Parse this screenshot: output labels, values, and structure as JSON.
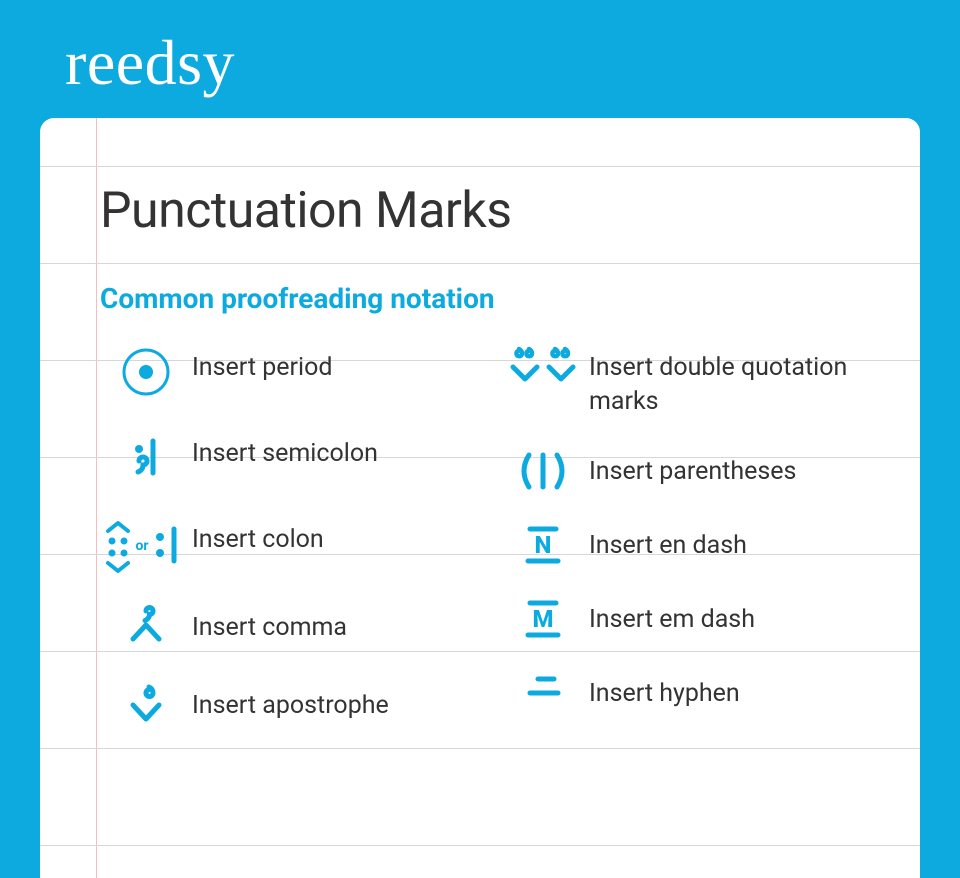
{
  "brand": {
    "name": "reedsy"
  },
  "heading": "Punctuation Marks",
  "subheading": "Common proofreading notation",
  "colon_or": "or",
  "marks": {
    "left": [
      {
        "label": "Insert period"
      },
      {
        "label": "Insert semicolon"
      },
      {
        "label": "Insert colon"
      },
      {
        "label": "Insert comma"
      },
      {
        "label": "Insert apostrophe"
      }
    ],
    "right": [
      {
        "label": "Insert double quotation marks"
      },
      {
        "label": "Insert parentheses"
      },
      {
        "label": "Insert en dash"
      },
      {
        "label": "Insert em dash"
      },
      {
        "label": "Insert hyphen"
      }
    ]
  }
}
